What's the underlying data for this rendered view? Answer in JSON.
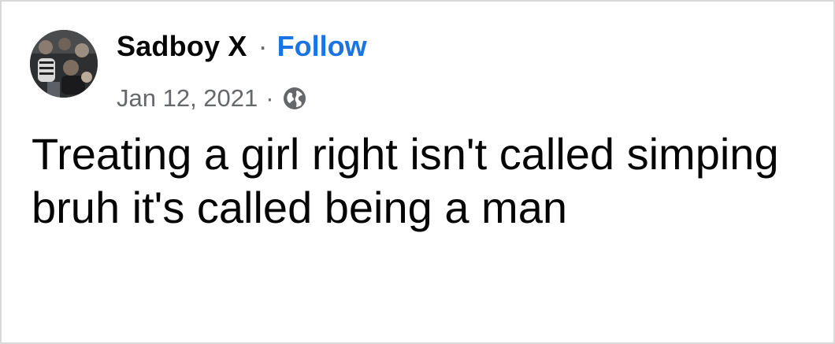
{
  "post": {
    "author": {
      "name": "Sadboy X",
      "avatar_icon": "profile-photo"
    },
    "separator": "·",
    "follow_label": "Follow",
    "date": "Jan 12, 2021",
    "privacy_icon": "globe-icon",
    "text": "Treating a girl right isn't called simping bruh it's called being a man"
  },
  "colors": {
    "name": "#050505",
    "secondary": "#65676b",
    "link": "#1b74e4",
    "border": "#d9d9d9",
    "background": "#ffffff"
  }
}
